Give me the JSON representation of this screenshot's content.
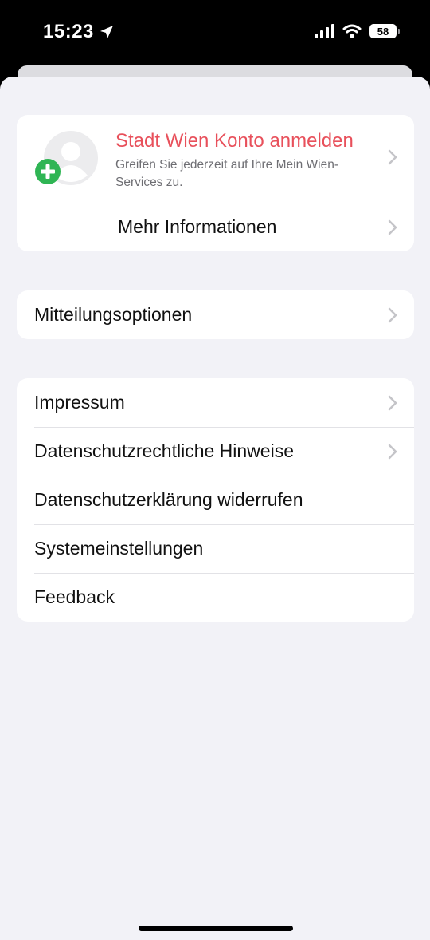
{
  "status_bar": {
    "time": "15:23",
    "battery": "58",
    "icons": [
      "location-arrow-icon",
      "cellular-signal-icon",
      "wifi-icon",
      "battery-icon"
    ]
  },
  "account": {
    "title": "Stadt Wien Konto anmelden",
    "subtitle": "Greifen Sie jederzeit auf Ihre Mein Wien-Services zu.",
    "more_label": "Mehr Informationen",
    "title_color": "#e8505b",
    "plus_color": "#2fb554"
  },
  "notifications": {
    "label": "Mitteilungsoptionen"
  },
  "legal": {
    "items": [
      {
        "label": "Impressum",
        "chevron": true
      },
      {
        "label": "Datenschutzrechtliche Hinweise",
        "chevron": true
      },
      {
        "label": "Datenschutzerklärung widerrufen",
        "chevron": false
      },
      {
        "label": "Systemeinstellungen",
        "chevron": false
      },
      {
        "label": "Feedback",
        "chevron": false
      }
    ]
  }
}
